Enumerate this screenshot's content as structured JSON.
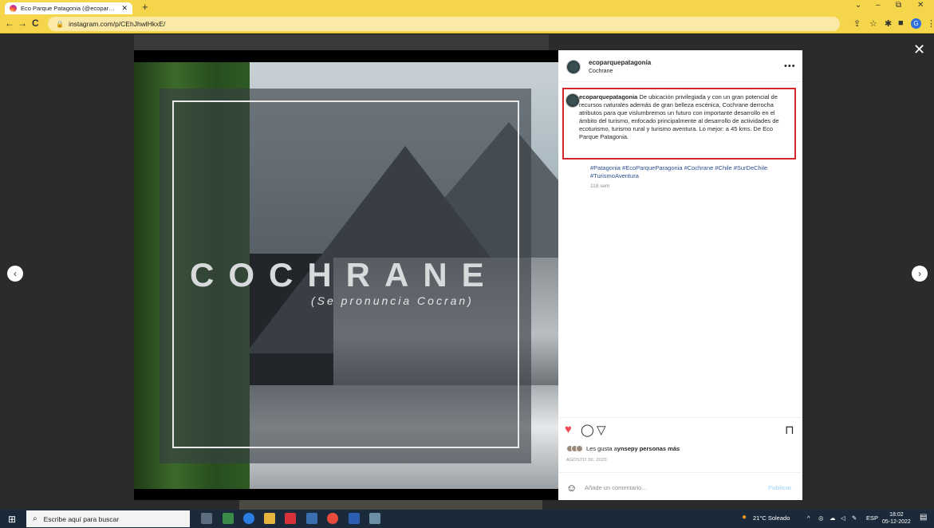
{
  "browser": {
    "tab_title": "Eco Parque Patagonia (@ecopar…",
    "tab_close": "✕",
    "new_tab": "+",
    "url": "instagram.com/p/CEhJhwlHkxE/",
    "back": "←",
    "forward": "→",
    "reload": "C",
    "window_controls": [
      "⌄",
      "–",
      "⧉",
      "✕"
    ],
    "profile_initial": "G"
  },
  "viewer": {
    "close": "✕",
    "prev": "‹",
    "next": "›"
  },
  "post_image": {
    "title": "COCHRANE",
    "subtitle": "(Se pronuncia Cocran)"
  },
  "post": {
    "username": "ecoparquepatagonia",
    "location": "Cochrane",
    "more": "•••",
    "caption_username": "ecoparquepatagonia",
    "caption_text": " De ubicación privilegiada y con un gran potencial de recursos naturales además de gran belleza escénica, Cochrane derrocha atributos para que vislumbremos un futuro con importante desarrollo en el ámbito del turismo, enfocado principalmente al desarrollo de actividades de ecoturismo, turismo rural y turismo aventura. Lo mejor: a 45 kms. De Eco Parque Patagonia.",
    "hashtags": "#Patagonia #EcoParqueParagonia #Cochrane #Chile #SurDeChile #TurismoAventura",
    "age": "118 sem",
    "likes_text": "Les gusta a ",
    "likes_user": "ynsep",
    "likes_more": " y personas más",
    "date": "AGOSTO 30, 2020",
    "comment_placeholder": "Añade un comentario...",
    "publish": "Publicar"
  },
  "taskbar": {
    "search_placeholder": "Escribe aquí para buscar",
    "weather": "21°C Soleado",
    "lang": "ESP",
    "time": "18:02",
    "date": "05-12-2022"
  },
  "colors": {
    "chrome_yellow": "#f5d54a",
    "ig_link": "#2d4e90",
    "highlight_red": "#d4262d",
    "heart": "#ed4956"
  }
}
